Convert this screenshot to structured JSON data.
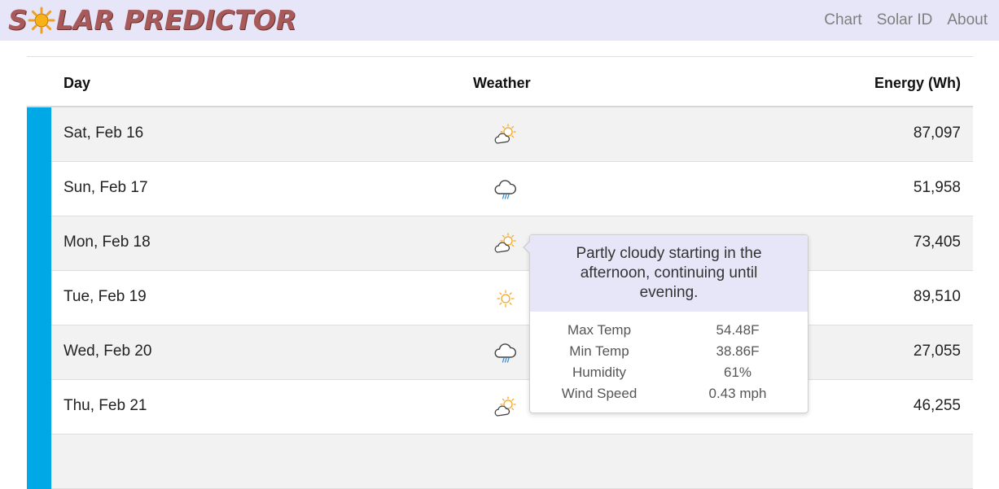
{
  "brand": {
    "title_left": "S",
    "title_right": "LAR PREDICTOR",
    "logo_icon": "sun-icon"
  },
  "nav": {
    "links": [
      "Chart",
      "Solar ID",
      "About"
    ]
  },
  "table": {
    "headers": {
      "day": "Day",
      "weather": "Weather",
      "energy": "Energy (Wh)"
    },
    "rows": [
      {
        "day": "Sat, Feb 16",
        "weather_icon": "partly-cloudy-icon",
        "energy": "87,097"
      },
      {
        "day": "Sun, Feb 17",
        "weather_icon": "rain-icon",
        "energy": "51,958"
      },
      {
        "day": "Mon, Feb 18",
        "weather_icon": "partly-cloudy-icon",
        "energy": "73,405"
      },
      {
        "day": "Tue, Feb 19",
        "weather_icon": "sun-icon",
        "energy": "89,510"
      },
      {
        "day": "Wed, Feb 20",
        "weather_icon": "rain-icon",
        "energy": "27,055"
      },
      {
        "day": "Thu, Feb 21",
        "weather_icon": "partly-cloudy-icon",
        "energy": "46,255"
      }
    ]
  },
  "tooltip": {
    "summary": "Partly cloudy starting in the afternoon, continuing until evening.",
    "details": [
      {
        "label": "Max Temp",
        "value": "54.48F"
      },
      {
        "label": "Min Temp",
        "value": "38.86F"
      },
      {
        "label": "Humidity",
        "value": "61%"
      },
      {
        "label": "Wind Speed",
        "value": "0.43 mph"
      }
    ]
  },
  "colors": {
    "navbar_bg": "#e6e6f8",
    "brand_text": "#a85a5a",
    "row_accent": "#00a8e6",
    "sun": "#f5a623"
  }
}
